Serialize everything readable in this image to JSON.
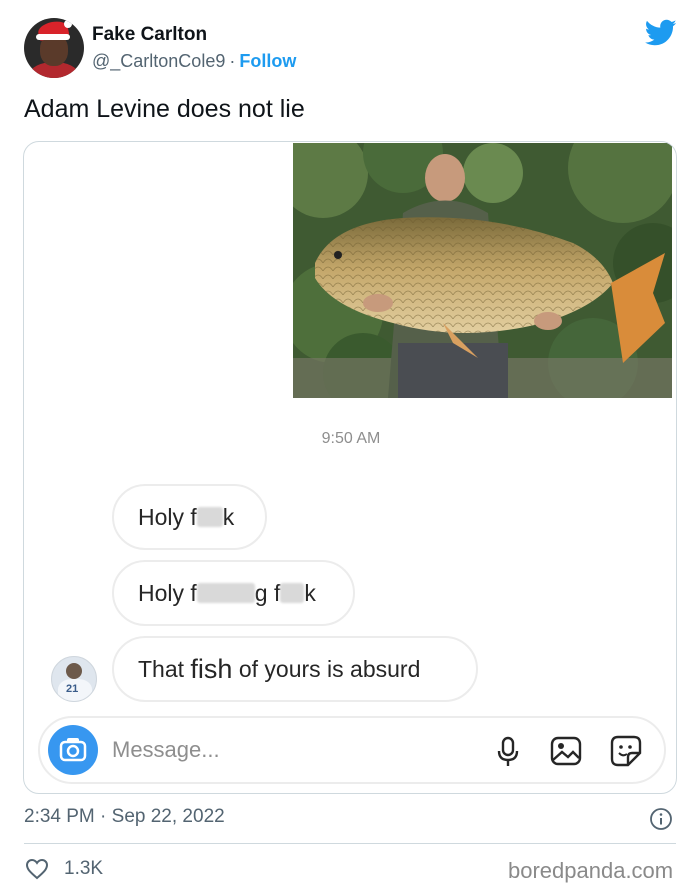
{
  "header": {
    "author_name": "Fake Carlton",
    "handle": "@_CarltonCole9",
    "separator": "·",
    "follow_label": "Follow"
  },
  "tweet_text": "Adam Levine does not lie",
  "dm": {
    "time": "9:50 AM",
    "messages": [
      {
        "before": "Holy f",
        "blur1": "",
        "after": "k"
      },
      {
        "before": "Holy f",
        "mid": "g f",
        "after": "k"
      },
      {
        "before": "That ",
        "emph": "fish",
        "after": " of yours is absurd"
      }
    ],
    "input_placeholder": "Message...",
    "avatar_number": "21"
  },
  "footer": {
    "time": "2:34 PM",
    "separator": "·",
    "date": "Sep 22, 2022",
    "likes": "1.3K",
    "watermark": "boredpanda.com"
  },
  "icons": {
    "twitter": "twitter-bird-icon",
    "camera": "camera-icon",
    "mic": "microphone-icon",
    "gallery": "image-gallery-icon",
    "sticker": "sticker-icon",
    "info": "info-icon",
    "heart": "heart-icon"
  },
  "colors": {
    "twitter_blue": "#1d9bf0",
    "instagram_blue": "#3797f0",
    "secondary_text": "#536471"
  }
}
